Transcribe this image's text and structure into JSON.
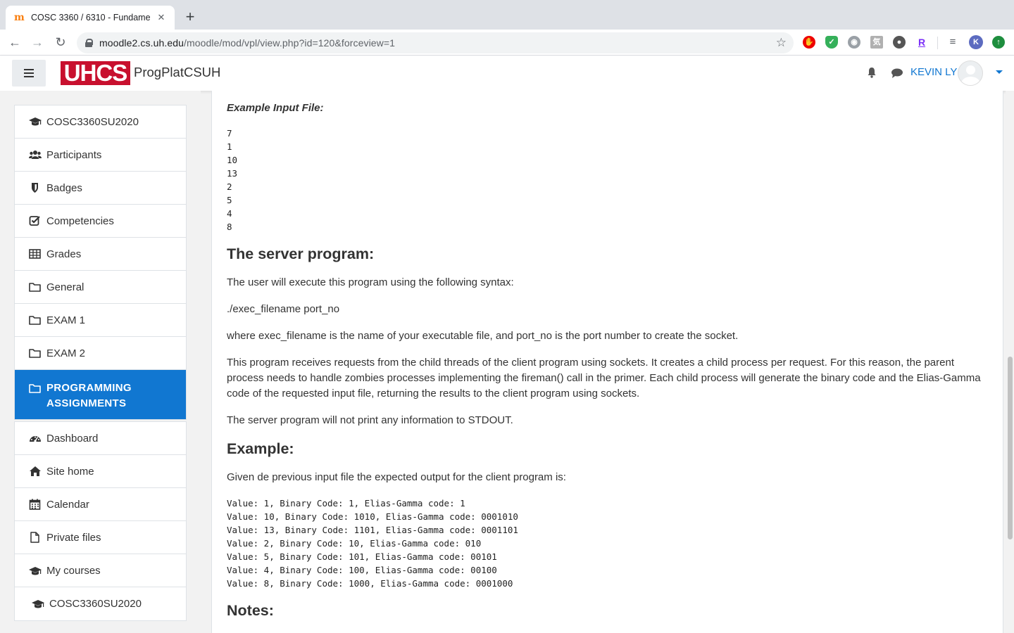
{
  "browser": {
    "tab_title": "COSC 3360 / 6310 - Fundame",
    "favicon_glyph": "m",
    "url_host": "moodle2.cs.uh.edu",
    "url_path": "/moodle/mod/vpl/view.php?id=120&forceview=1",
    "profile_initial": "K",
    "extensions": [
      "adblock-icon",
      "shield-extension-icon",
      "discord-icon",
      "kanji-extension-icon",
      "circle-extension-icon",
      "r-extension-icon",
      "playlist-icon",
      "profile-icon",
      "update-icon"
    ],
    "extension_r_letter": "R"
  },
  "header": {
    "logo_text": "UHCS",
    "site_name": "ProgPlatCSUH",
    "user_name": "KEVIN LY"
  },
  "sidebar": {
    "group1": [
      {
        "label": "COSC3360SU2020",
        "icon": "graduation-cap-icon"
      },
      {
        "label": "Participants",
        "icon": "users-icon"
      },
      {
        "label": "Badges",
        "icon": "shield-icon"
      },
      {
        "label": "Competencies",
        "icon": "check-square-icon"
      },
      {
        "label": "Grades",
        "icon": "table-icon"
      },
      {
        "label": "General",
        "icon": "folder-icon"
      },
      {
        "label": "EXAM 1",
        "icon": "folder-icon"
      },
      {
        "label": "EXAM 2",
        "icon": "folder-icon"
      },
      {
        "label": "PROGRAMMING ASSIGNMENTS",
        "icon": "folder-icon",
        "active": true
      }
    ],
    "group2": [
      {
        "label": "Dashboard",
        "icon": "tachometer-icon"
      },
      {
        "label": "Site home",
        "icon": "home-icon"
      },
      {
        "label": "Calendar",
        "icon": "calendar-icon"
      },
      {
        "label": "Private files",
        "icon": "file-icon"
      },
      {
        "label": "My courses",
        "icon": "graduation-cap-icon"
      }
    ],
    "group3": [
      {
        "label": "COSC3360SU2020",
        "icon": "graduation-cap-icon"
      }
    ]
  },
  "content": {
    "example_input_label": "Example Input File:",
    "example_input": "7\n1\n10\n13\n2\n5\n4\n8",
    "server_heading": "The server program:",
    "p_syntax": "The user will execute this program using the following syntax:",
    "p_command": "./exec_filename port_no",
    "p_where": "where exec_filename is the name of your executable file, and port_no is the port number to create the socket.",
    "p_receives": "This program receives requests from the child threads of the client program using sockets. It creates a child process per request. For this reason, the parent process needs to handle zombies processes implementing the fireman() call in the primer. Each child process will generate the binary code and the Elias-Gamma code of the requested input file, returning the results to the client program using sockets.",
    "p_stdout": "The server program will not print any information to STDOUT.",
    "example_heading": "Example:",
    "p_given": "Given de previous input file the expected output for the client program is:",
    "example_output": "Value: 1, Binary Code: 1, Elias-Gamma code: 1\nValue: 10, Binary Code: 1010, Elias-Gamma code: 0001010\nValue: 13, Binary Code: 1101, Elias-Gamma code: 0001101\nValue: 2, Binary Code: 10, Elias-Gamma code: 010\nValue: 5, Binary Code: 101, Elias-Gamma code: 00101\nValue: 4, Binary Code: 100, Elias-Gamma code: 00100\nValue: 8, Binary Code: 1000, Elias-Gamma code: 0001000",
    "notes_heading": "Notes:"
  },
  "colors": {
    "accent": "#1177d1",
    "logo_red": "#c8102e"
  }
}
